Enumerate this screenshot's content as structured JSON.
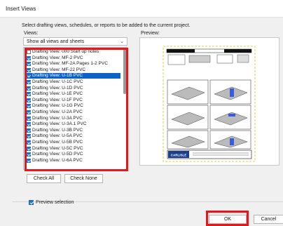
{
  "window": {
    "title": "Insert Views"
  },
  "instruction": "Select drafting views, schedules, or reports to be added to the current project.",
  "views_label": "Views:",
  "preview_label": "Preview:",
  "filter": {
    "selected": "Show all views and sheets"
  },
  "views": [
    {
      "label": "Drafting View: 000 Start up notes",
      "checked": false,
      "selected": false
    },
    {
      "label": "Drafting View: MF-2 PVC",
      "checked": true,
      "selected": false
    },
    {
      "label": "Drafting View: MF-2A Pages 1-2 PVC",
      "checked": true,
      "selected": false
    },
    {
      "label": "Drafting View: MF-22 PVC",
      "checked": true,
      "selected": false
    },
    {
      "label": "Drafting View: U-1B PVC",
      "checked": true,
      "selected": true
    },
    {
      "label": "Drafting View: U-1C PVC",
      "checked": true,
      "selected": false
    },
    {
      "label": "Drafting View: U-1D PVC",
      "checked": true,
      "selected": false
    },
    {
      "label": "Drafting View: U-1E PVC",
      "checked": true,
      "selected": false
    },
    {
      "label": "Drafting View: U-1F PVC",
      "checked": true,
      "selected": false
    },
    {
      "label": "Drafting View: U-1G PVC",
      "checked": true,
      "selected": false
    },
    {
      "label": "Drafting View: U-2A PVC",
      "checked": true,
      "selected": false
    },
    {
      "label": "Drafting View: U-3A PVC",
      "checked": true,
      "selected": false
    },
    {
      "label": "Drafting View: U-3A.1 PVC",
      "checked": true,
      "selected": false
    },
    {
      "label": "Drafting View: U-3B PVC",
      "checked": true,
      "selected": false
    },
    {
      "label": "Drafting View: U-5A PVC",
      "checked": true,
      "selected": false
    },
    {
      "label": "Drafting View: U-5B PVC",
      "checked": true,
      "selected": false
    },
    {
      "label": "Drafting View: U-5C PVC",
      "checked": true,
      "selected": false
    },
    {
      "label": "Drafting View: U-5D PVC",
      "checked": true,
      "selected": false
    },
    {
      "label": "Drafting View: U-6A PVC",
      "checked": true,
      "selected": false
    }
  ],
  "buttons": {
    "check_all": "Check All",
    "check_none": "Check None",
    "ok": "OK",
    "cancel": "Cancel"
  },
  "preview_selection": {
    "label": "Preview selection",
    "checked": true
  },
  "preview_sheet": {
    "brand": "CARLISLE"
  },
  "colors": {
    "selection": "#0b63c7",
    "highlight": "#e8151b",
    "checkbox": "#1a6fd1"
  }
}
